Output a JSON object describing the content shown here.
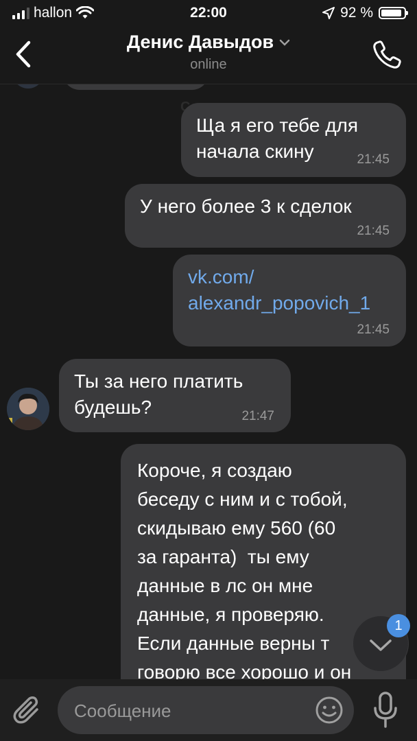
{
  "status": {
    "carrier": "hallon",
    "time": "22:00",
    "battery": "92 %",
    "battery_level": 0.92
  },
  "header": {
    "name": "Денис Давыдов",
    "status": "online"
  },
  "messages": [
    {
      "text": "Ща я его тебе для\nначала скину",
      "time": "21:45"
    },
    {
      "text": "У него более 3 к сделок",
      "time": "21:45"
    },
    {
      "text": "vk.com/\nalexandr_popovich_1",
      "time": "21:45"
    },
    {
      "text": "Ты за него платить\nбудешь?",
      "time": "21:47"
    },
    {
      "text": "Короче, я создаю\nбеседу с ним и с тобой,\nскидываю ему 560 (60\nза гаранта)  ты ему\nданные в лс он мне\nданные, я проверяю.\nЕсли данные верны т\nговорю все хорошо и он"
    }
  ],
  "date_separator": "Сегодня",
  "scroll": {
    "unread_count": "1"
  },
  "composer": {
    "placeholder": "Сообщение"
  }
}
